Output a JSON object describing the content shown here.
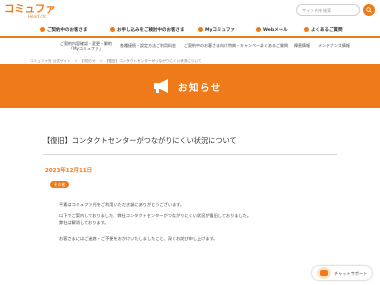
{
  "logo": {
    "text": "コミュファ",
    "sub": "Heart ctc"
  },
  "search": {
    "placeholder": "サイト内を検索"
  },
  "nav": {
    "items": [
      {
        "label": "ご契約中のお客さま"
      },
      {
        "label": "お申し込みをご検討中のお客さま"
      },
      {
        "label": "Myコミュファ"
      },
      {
        "label": "Webメール"
      },
      {
        "label": "よくあるご質問"
      }
    ]
  },
  "subnav": {
    "items": [
      {
        "label": "ご契約内容確認・変更・解約\n「Myコミュファ」"
      },
      {
        "label": "各種接続・設定方法"
      },
      {
        "label": "ご利用料金"
      },
      {
        "label": "ご契約中のお客さま向け特典・キャンペーン"
      },
      {
        "label": "よくあるご質問"
      },
      {
        "label": "障害情報"
      },
      {
        "label": "メンテナンス情報"
      }
    ]
  },
  "breadcrumb": "コミュファ光 公式サイト　＞　お知らせ　＞　【復旧】コンタクトセンターがつながりにくい状況について",
  "banner": {
    "title": "お知らせ"
  },
  "article": {
    "title": "【復旧】コンタクトセンターがつながりにくい状況について",
    "date": "2023年12月11日",
    "badge": "その他",
    "lines": [
      "平素はコミュファ光をご利用いただき誠にありがとうございます。",
      "以下でご案内しておりました、弊社コンタクトセンターがつながりにくい状況が復旧しておりました。",
      "弊社は解消しております。",
      "お客さまにはご迷惑・ご不便をおかけいたしましたこと、深くお詫び申し上げます。"
    ]
  },
  "support": {
    "label": "チャットサポート"
  },
  "colors": {
    "accent": "#ef7a1a"
  }
}
